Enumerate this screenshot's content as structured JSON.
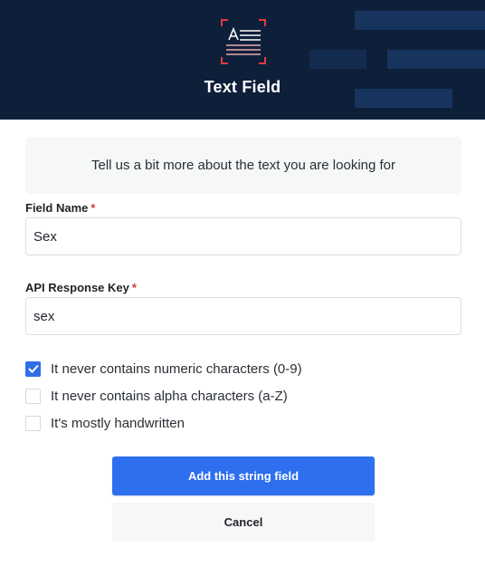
{
  "header": {
    "title": "Text Field",
    "icon": "text-field-icon",
    "colors": {
      "background": "#0e1f3a",
      "accent": "#e23b3b"
    }
  },
  "info": {
    "text": "Tell us a bit more about the text you are looking for"
  },
  "fields": {
    "field_name": {
      "label": "Field Name",
      "required_marker": "*",
      "value": "Sex"
    },
    "api_key": {
      "label": "API Response Key",
      "required_marker": "*",
      "value": "sex"
    }
  },
  "options": [
    {
      "label": "It never contains numeric characters (0-9)",
      "checked": true
    },
    {
      "label": "It never contains alpha characters (a-Z)",
      "checked": false
    },
    {
      "label": "It's mostly handwritten",
      "checked": false
    }
  ],
  "actions": {
    "add_label": "Add this string field",
    "cancel_label": "Cancel",
    "primary_color": "#2d6fef"
  }
}
